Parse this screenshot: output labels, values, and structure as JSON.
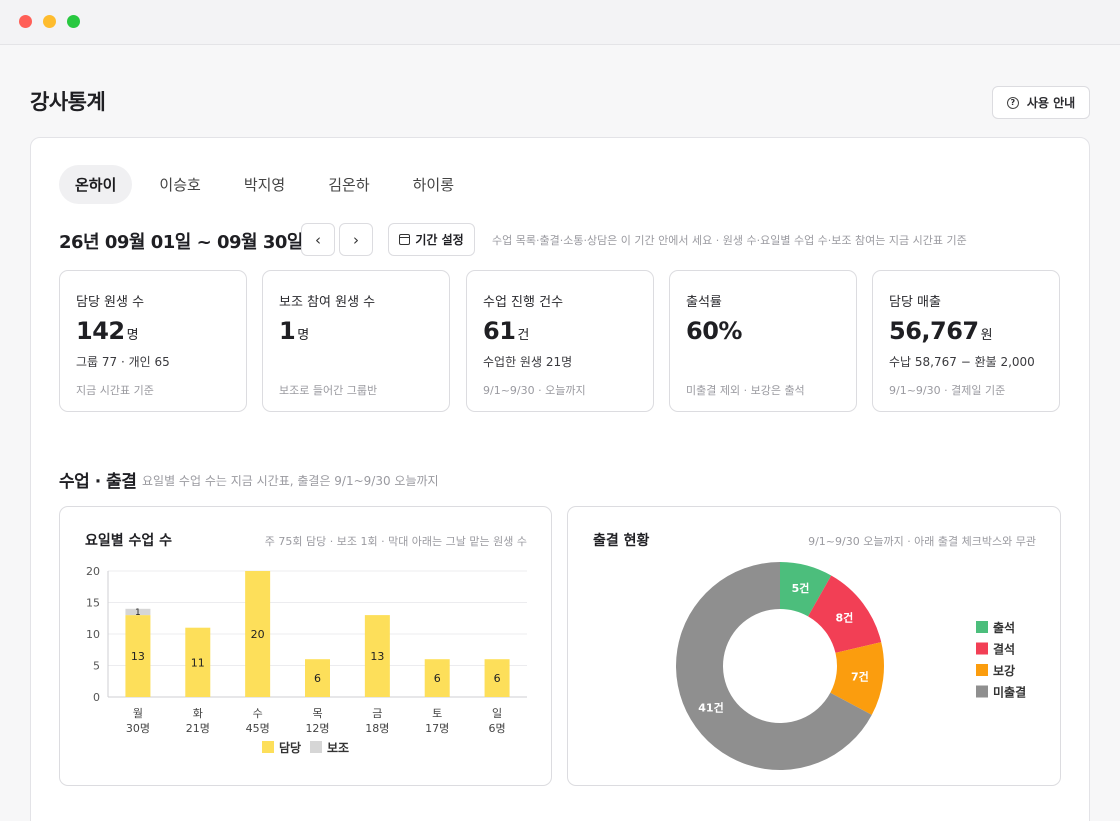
{
  "page": {
    "title": "강사통계",
    "help_label": "사용 안내"
  },
  "tabs": [
    {
      "label": "온하이",
      "active": true
    },
    {
      "label": "이승호",
      "active": false
    },
    {
      "label": "박지영",
      "active": false
    },
    {
      "label": "김온하",
      "active": false
    },
    {
      "label": "하이롱",
      "active": false
    }
  ],
  "period": {
    "range": "26년 09월 01일 ~ 09월 30일",
    "prev_icon": "chevron-left-icon",
    "next_icon": "chevron-right-icon",
    "set_label": "기간 설정",
    "note": "수업 목록·출결·소통·상담은 이 기간 안에서 세요 · 원생 수·요일별 수업 수·보조 참여는 지금 시간표 기준"
  },
  "cards": [
    {
      "label": "담당 원생 수",
      "value": "142",
      "unit": "명",
      "sub": "그룹 77 · 개인 65",
      "foot": "지금 시간표 기준"
    },
    {
      "label": "보조 참여 원생 수",
      "value": "1",
      "unit": "명",
      "sub": "",
      "foot": "보조로 들어간 그룹반"
    },
    {
      "label": "수업 진행 건수",
      "value": "61",
      "unit": "건",
      "sub": "수업한 원생 21명",
      "foot": "9/1~9/30 · 오늘까지"
    },
    {
      "label": "출석률",
      "value": "60%",
      "unit": "",
      "sub": "",
      "foot": "미출결 제외 · 보강은 출석"
    },
    {
      "label": "담당 매출",
      "value": "56,767",
      "unit": "원",
      "sub": "수납 58,767 − 환불 2,000",
      "foot": "9/1~9/30 · 결제일 기준"
    }
  ],
  "section": {
    "title": "수업 · 출결",
    "note": "요일별 수업 수는 지금 시간표, 출결은 9/1~9/30 오늘까지"
  },
  "colors": {
    "main": "#fddf5a",
    "assist": "#d6d6d6",
    "present": "#4cbe7c",
    "absent": "#f23f55",
    "makeup": "#fb9d0e",
    "unchecked": "#8f8f8f"
  },
  "chart_data": [
    {
      "type": "bar",
      "title": "요일별 수업 수",
      "note": "주 75회 담당 · 보조 1회 · 막대 아래는 그날 맡는 원생 수",
      "categories": [
        "월",
        "화",
        "수",
        "목",
        "금",
        "토",
        "일"
      ],
      "sublabels": [
        "30명",
        "21명",
        "45명",
        "12명",
        "18명",
        "17명",
        "6명"
      ],
      "series": [
        {
          "name": "담당",
          "values": [
            13,
            11,
            20,
            6,
            13,
            6,
            6
          ]
        },
        {
          "name": "보조",
          "values": [
            1,
            0,
            0,
            0,
            0,
            0,
            0
          ]
        }
      ],
      "ylim": [
        0,
        20
      ],
      "yticks": [
        0,
        5,
        10,
        15,
        20
      ],
      "stacked": true,
      "grid": true,
      "legend": "bottom"
    },
    {
      "type": "pie",
      "donut": true,
      "title": "출결 현황",
      "note": "9/1~9/30 오늘까지 · 아래 출결 체크박스와 무관",
      "categories": [
        "출석",
        "결석",
        "보강",
        "미출결"
      ],
      "values": [
        5,
        8,
        7,
        41
      ],
      "value_labels": [
        "5건",
        "8건",
        "7건",
        "41건"
      ],
      "legend": "right"
    }
  ]
}
